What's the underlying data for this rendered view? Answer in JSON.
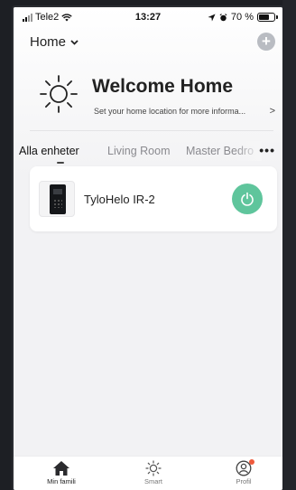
{
  "status_bar": {
    "carrier": "Tele2",
    "time": "13:27",
    "battery": "70 %"
  },
  "header": {
    "home_label": "Home",
    "add_label": "+"
  },
  "welcome": {
    "title": "Welcome Home",
    "subtitle": "Set your home location for more informa...",
    "chevron": ">"
  },
  "tabs": [
    {
      "label": "Alla enheter",
      "active": true
    },
    {
      "label": "Living Room",
      "active": false
    },
    {
      "label": "Master Bedro",
      "active": false
    }
  ],
  "more_label": "•••",
  "device": {
    "name": "TyloHelo IR-2",
    "power_state": "on"
  },
  "bottom_nav": [
    {
      "label": "Min famili",
      "icon": "home-icon",
      "active": true
    },
    {
      "label": "Smart",
      "icon": "sun-icon",
      "active": false
    },
    {
      "label": "Profil",
      "icon": "profile-icon",
      "active": false
    }
  ],
  "colors": {
    "accent_green": "#5fc59c",
    "badge_red": "#ef5a3c",
    "background": "#f2f2f4"
  }
}
